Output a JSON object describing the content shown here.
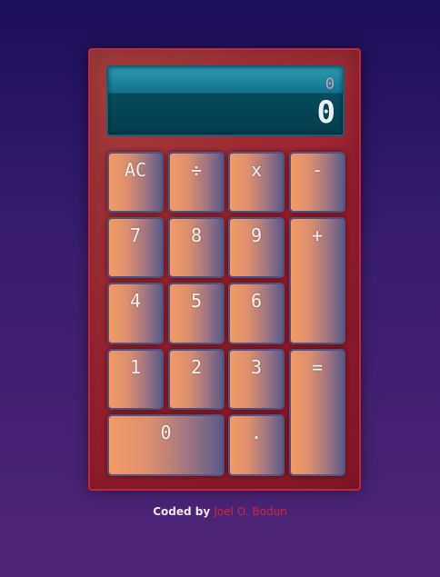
{
  "display": {
    "previous": "0",
    "current": "0"
  },
  "keys": {
    "ac": "AC",
    "divide": "÷",
    "multiply": "x",
    "subtract": "-",
    "seven": "7",
    "eight": "8",
    "nine": "9",
    "add": "+",
    "four": "4",
    "five": "5",
    "six": "6",
    "one": "1",
    "two": "2",
    "three": "3",
    "equals": "=",
    "zero": "0",
    "decimal": "."
  },
  "footer": {
    "prefix": "Coded by",
    "author": "Joel O. Bodun"
  },
  "colors": {
    "accent": "#d0253f",
    "body": "#9b2030",
    "screen": "#11728c"
  }
}
